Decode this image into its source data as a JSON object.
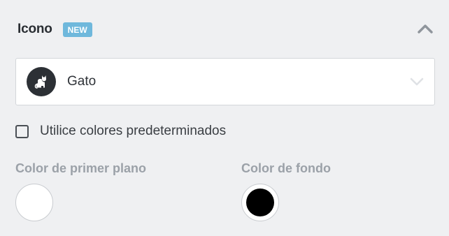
{
  "section": {
    "title": "Icono",
    "badge": "NEW"
  },
  "icon_select": {
    "value": "Gato",
    "icon": "cat-icon"
  },
  "default_colors": {
    "label": "Utilice colores predeterminados",
    "checked": false
  },
  "foreground": {
    "label": "Color de primer plano",
    "color": "#ffffff"
  },
  "background": {
    "label": "Color de fondo",
    "color": "#000000"
  },
  "colors": {
    "badge": "#6fb8dc",
    "page_bg": "#eff0f2"
  }
}
